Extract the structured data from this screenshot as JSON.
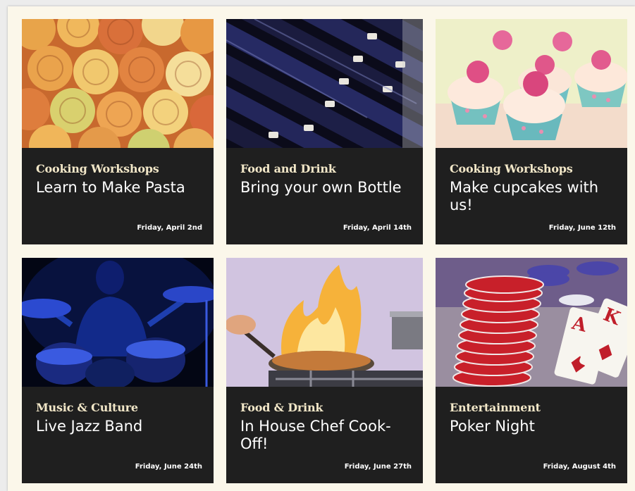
{
  "events": [
    {
      "category": "Cooking Workshops",
      "title": "Learn to Make Pasta",
      "date": "Friday, April 2nd",
      "image": "pasta-nests-photo"
    },
    {
      "category": "Food and Drink",
      "title": "Bring your own Bottle",
      "date": "Friday, April 14th",
      "image": "wine-bottles-photo"
    },
    {
      "category": "Cooking Workshops",
      "title": "Make cupcakes with us!",
      "date": "Friday, June 12th",
      "image": "cupcakes-photo"
    },
    {
      "category": "Music & Culture",
      "title": "Live Jazz Band",
      "date": "Friday, June 24th",
      "image": "drummer-photo"
    },
    {
      "category": "Food & Drink",
      "title": "In House Chef Cook-Off!",
      "date": "Friday, June 27th",
      "image": "flambe-pan-photo"
    },
    {
      "category": "Entertainment",
      "title": "Poker Night",
      "date": "Friday, August 4th",
      "image": "poker-chips-cards-photo"
    }
  ]
}
